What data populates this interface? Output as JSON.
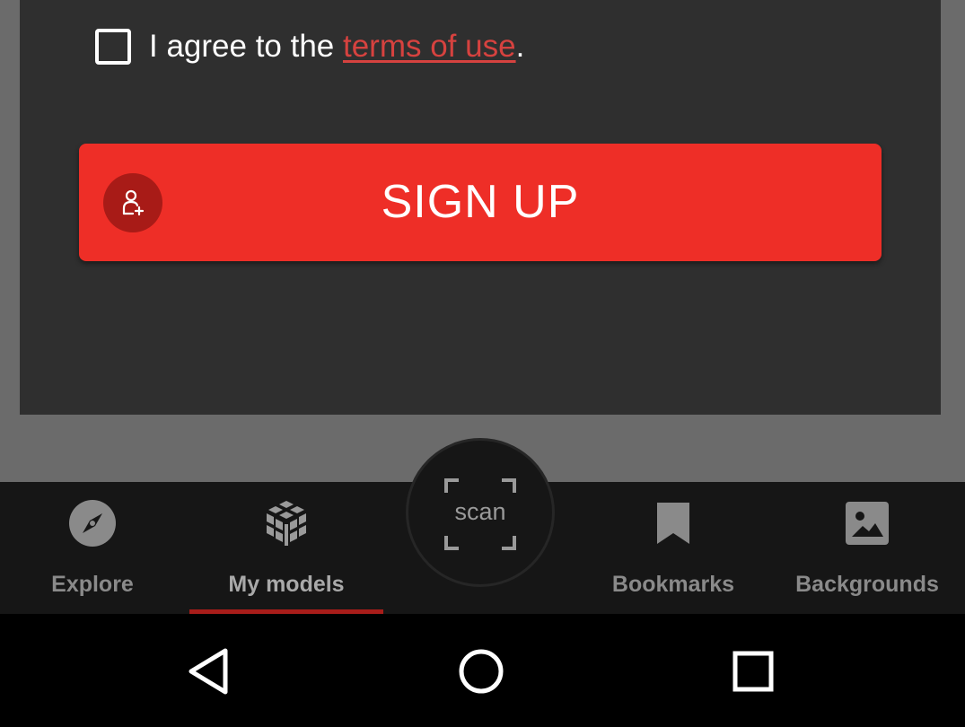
{
  "terms": {
    "prefix": "I agree to the ",
    "link_text": "terms of use",
    "suffix": ".",
    "checked": false
  },
  "signup": {
    "label": "SIGN UP",
    "icon": "add-user-icon"
  },
  "bottom_nav": {
    "items": [
      {
        "label": "Explore",
        "icon": "compass-icon",
        "active": false
      },
      {
        "label": "My models",
        "icon": "cube-icon",
        "active": true
      },
      {
        "label": "Bookmarks",
        "icon": "bookmark-icon",
        "active": false
      },
      {
        "label": "Backgrounds",
        "icon": "image-icon",
        "active": false
      }
    ],
    "scan": {
      "label": "scan",
      "icon": "scan-frame-icon"
    }
  },
  "system_nav": {
    "back_icon": "back-triangle-icon",
    "home_icon": "home-circle-icon",
    "recents_icon": "recents-square-icon"
  },
  "colors": {
    "accent": "#ee2e27",
    "link": "#d6423f",
    "card_bg": "#2f2f2f",
    "nav_bg": "#161616"
  }
}
